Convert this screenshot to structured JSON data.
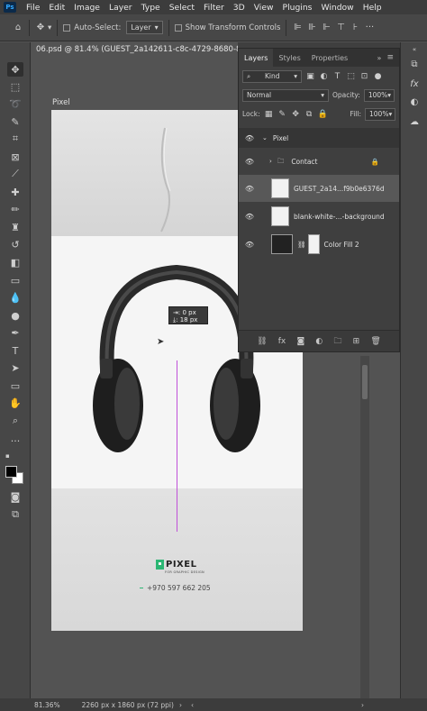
{
  "app": {
    "logo": "Ps"
  },
  "menu": [
    "File",
    "Edit",
    "Image",
    "Layer",
    "Type",
    "Select",
    "Filter",
    "3D",
    "View",
    "Plugins",
    "Window",
    "Help"
  ],
  "options": {
    "auto_select_label": "Auto-Select:",
    "layer_dropdown": "Layer",
    "show_transform_label": "Show Transform Controls"
  },
  "document": {
    "tab_title": "06.psd @ 81.4% (GUEST_2a142611-c8c-4729-8680-89f9"
  },
  "canvas": {
    "artboard_label": "Pixel",
    "measure_line1": "0 px",
    "measure_line2": "18 px",
    "logo_text": "PIXEL",
    "logo_subtitle": "FOR GRAPHIC DESIGN",
    "phone": "+970 597 662 205"
  },
  "layers_panel": {
    "tabs": [
      "Layers",
      "Styles",
      "Properties"
    ],
    "kind_label": "Kind",
    "blend_mode": "Normal",
    "opacity_label": "Opacity:",
    "opacity_value": "100%",
    "lock_label": "Lock:",
    "fill_label": "Fill:",
    "fill_value": "100%",
    "layers": [
      {
        "name": "Pixel",
        "type": "artboard"
      },
      {
        "name": "Contact",
        "type": "group"
      },
      {
        "name": "GUEST_2a14...f9b0e6376d",
        "type": "smart-object"
      },
      {
        "name": "blank-white-...-background",
        "type": "smart-object"
      },
      {
        "name": "Color Fill 2",
        "type": "fill"
      }
    ]
  },
  "status": {
    "zoom": "81.36%",
    "doc_info": "2260 px x 1860 px (72 ppi)"
  },
  "colors": {
    "accent_green": "#2bb673",
    "guide_magenta": "#c050d8",
    "panel_bg": "#3f3f3f"
  }
}
